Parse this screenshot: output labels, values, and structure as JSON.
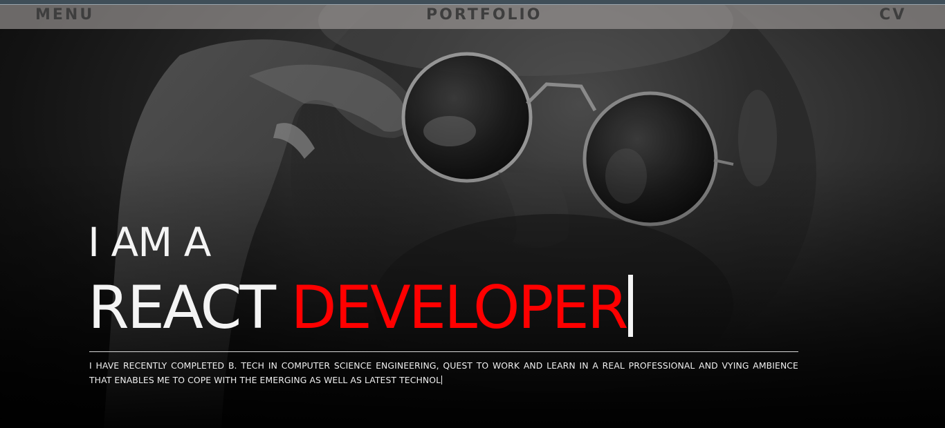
{
  "nav": {
    "menu_label": "MENU",
    "portfolio_label": "PORTFOLIO",
    "cv_label": "CV"
  },
  "hero": {
    "line1": "I AM A",
    "line2_word1": "REACT",
    "line2_word2": "DEVELOPER",
    "bio_line1": "I HAVE RECENTLY COMPLETED B. TECH IN COMPUTER SCIENCE ENGINEERING, QUEST TO WORK AND LEARN IN A REAL PROFESSIONAL AND VYING AMBIENCE",
    "bio_line2": "THAT ENABLES ME TO COPE WITH THE EMERGING AS WELL AS LATEST TECHNOL"
  },
  "colors": {
    "accent": "#ff0000",
    "text": "#f4f4f4",
    "navbar": "#a5a09e",
    "background": "#000000"
  }
}
